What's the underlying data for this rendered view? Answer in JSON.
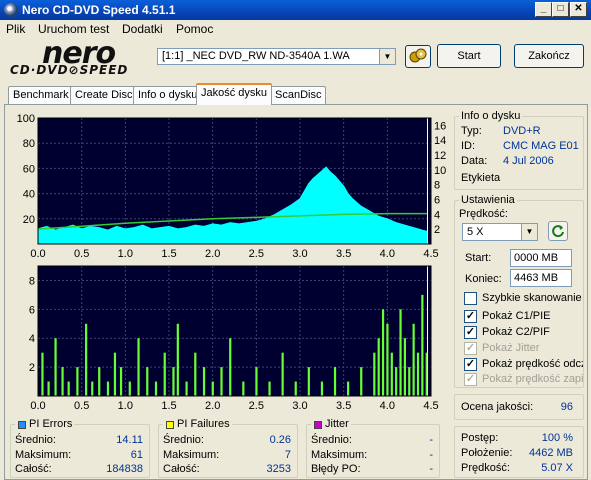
{
  "window": {
    "title": "Nero CD-DVD Speed 4.51.1"
  },
  "menu": [
    "Plik",
    "Uruchom test",
    "Dodatki",
    "Pomoc"
  ],
  "logo": {
    "line1": "nero",
    "line2": "CD·DVD⊘SPEED"
  },
  "toolbar": {
    "drive": "[1:1]  _NEC DVD_RW ND-3540A 1.WA",
    "start_label": "Start",
    "end_label": "Zakończ"
  },
  "tabs": [
    {
      "label": "Benchmark",
      "active": false
    },
    {
      "label": "Create Disc",
      "active": false
    },
    {
      "label": "Info o dysku",
      "active": false
    },
    {
      "label": "Jakość dysku",
      "active": true
    },
    {
      "label": "ScanDisc",
      "active": false
    }
  ],
  "disc_info": {
    "title": "Info o dysku",
    "type_label": "Typ:",
    "type_value": "DVD+R",
    "id_label": "ID:",
    "id_value": "CMC MAG E01",
    "date_label": "Data:",
    "date_value": "4 Jul 2006",
    "label_label": "Etykieta"
  },
  "settings": {
    "title": "Ustawienia",
    "speed_label": "Prędkość:",
    "speed_value": "5 X",
    "start_label": "Start:",
    "start_value": "0000 MB",
    "end_label": "Koniec:",
    "end_value": "4463 MB",
    "checkboxes": [
      {
        "label": "Szybkie skanowanie",
        "checked": false,
        "disabled": false
      },
      {
        "label": "Pokaż C1/PIE",
        "checked": true,
        "disabled": false
      },
      {
        "label": "Pokaż C2/PIF",
        "checked": true,
        "disabled": false
      },
      {
        "label": "Pokaż Jitter",
        "checked": true,
        "disabled": true
      },
      {
        "label": "Pokaż prędkość odczy",
        "checked": true,
        "disabled": false
      },
      {
        "label": "Pokaż prędkość zapisu",
        "checked": true,
        "disabled": true
      }
    ]
  },
  "quality": {
    "label": "Ocena jakości:",
    "value": "96"
  },
  "progress": {
    "progress_label": "Postęp:",
    "progress_value": "100 %",
    "position_label": "Położenie:",
    "position_value": "4462 MB",
    "speed_label": "Prędkość:",
    "speed_value": "5.07 X"
  },
  "pi_errors": {
    "title": "PI Errors",
    "avg_label": "Średnio:",
    "avg_value": "14.11",
    "max_label": "Maksimum:",
    "max_value": "61",
    "total_label": "Całość:",
    "total_value": "184838"
  },
  "pi_failures": {
    "title": "PI Failures",
    "avg_label": "Średnio:",
    "avg_value": "0.26",
    "max_label": "Maksimum:",
    "max_value": "7",
    "total_label": "Całość:",
    "total_value": "3253"
  },
  "jitter": {
    "title": "Jitter",
    "avg_label": "Średnio:",
    "avg_value": "-",
    "max_label": "Maksimum:",
    "max_value": "-",
    "po_label": "Błędy PO:",
    "po_value": "-"
  },
  "colors": {
    "pie": "#00ffff",
    "pif": "#66ff33",
    "speed": "#33cc33",
    "chart_bg": "#000030",
    "jitter": "#cc00cc",
    "pi_swatch": "#1e90ff",
    "pif_swatch": "#ffff00"
  },
  "chart_data": [
    {
      "type": "area",
      "x_ticks": [
        "0.0",
        "0.5",
        "1.0",
        "1.5",
        "2.0",
        "2.5",
        "3.0",
        "3.5",
        "4.0",
        "4.5"
      ],
      "y_left_ticks": [
        "100",
        "80",
        "60",
        "40",
        "20"
      ],
      "y_right_ticks": [
        "16",
        "14",
        "12",
        "10",
        "8",
        "6",
        "4",
        "2"
      ],
      "xlim": [
        0,
        4.5
      ],
      "ylim": [
        0,
        100
      ],
      "y2lim": [
        0,
        17
      ],
      "series": [
        {
          "values": [
            [
              0.0,
              12
            ],
            [
              0.1,
              14
            ],
            [
              0.2,
              11
            ],
            [
              0.3,
              13
            ],
            [
              0.4,
              15
            ],
            [
              0.5,
              12
            ],
            [
              0.6,
              14
            ],
            [
              0.7,
              13
            ],
            [
              0.8,
              11
            ],
            [
              0.9,
              14
            ],
            [
              1.0,
              12
            ],
            [
              1.1,
              13
            ],
            [
              1.2,
              15
            ],
            [
              1.3,
              12
            ],
            [
              1.4,
              13
            ],
            [
              1.5,
              14
            ],
            [
              1.6,
              12
            ],
            [
              1.7,
              13
            ],
            [
              1.8,
              15
            ],
            [
              1.9,
              14
            ],
            [
              2.0,
              16
            ],
            [
              2.1,
              15
            ],
            [
              2.2,
              17
            ],
            [
              2.3,
              16
            ],
            [
              2.4,
              17
            ],
            [
              2.5,
              18
            ],
            [
              2.6,
              20
            ],
            [
              2.7,
              23
            ],
            [
              2.8,
              27
            ],
            [
              2.9,
              31
            ],
            [
              3.0,
              36
            ],
            [
              3.05,
              42
            ],
            [
              3.1,
              48
            ],
            [
              3.15,
              52
            ],
            [
              3.2,
              55
            ],
            [
              3.25,
              58
            ],
            [
              3.3,
              61
            ],
            [
              3.35,
              57
            ],
            [
              3.4,
              54
            ],
            [
              3.45,
              50
            ],
            [
              3.5,
              46
            ],
            [
              3.55,
              40
            ],
            [
              3.6,
              36
            ],
            [
              3.7,
              30
            ],
            [
              3.8,
              26
            ],
            [
              3.9,
              22
            ],
            [
              4.0,
              20
            ],
            [
              4.1,
              17
            ],
            [
              4.2,
              15
            ],
            [
              4.3,
              13
            ],
            [
              4.4,
              11
            ],
            [
              4.46,
              10
            ]
          ]
        },
        {
          "axis": "right",
          "values": [
            [
              0.0,
              2.0
            ],
            [
              0.5,
              2.4
            ],
            [
              1.0,
              2.8
            ],
            [
              1.5,
              3.1
            ],
            [
              2.0,
              3.4
            ],
            [
              2.5,
              3.6
            ],
            [
              3.0,
              3.8
            ],
            [
              3.5,
              4.0
            ],
            [
              4.0,
              4.1
            ],
            [
              4.46,
              4.1
            ]
          ]
        }
      ]
    },
    {
      "type": "bar",
      "x_ticks": [
        "0.0",
        "0.5",
        "1.0",
        "1.5",
        "2.0",
        "2.5",
        "3.0",
        "3.5",
        "4.0",
        "4.5"
      ],
      "y_ticks": [
        "8",
        "6",
        "4",
        "2"
      ],
      "xlim": [
        0,
        4.5
      ],
      "ylim": [
        0,
        9
      ],
      "series": [
        {
          "values": [
            [
              0.05,
              3
            ],
            [
              0.12,
              1
            ],
            [
              0.2,
              4
            ],
            [
              0.28,
              2
            ],
            [
              0.35,
              1
            ],
            [
              0.45,
              2
            ],
            [
              0.55,
              5
            ],
            [
              0.62,
              1
            ],
            [
              0.7,
              2
            ],
            [
              0.8,
              1
            ],
            [
              0.88,
              3
            ],
            [
              0.95,
              2
            ],
            [
              1.05,
              1
            ],
            [
              1.15,
              4
            ],
            [
              1.25,
              2
            ],
            [
              1.35,
              1
            ],
            [
              1.45,
              3
            ],
            [
              1.55,
              2
            ],
            [
              1.6,
              5
            ],
            [
              1.7,
              1
            ],
            [
              1.8,
              3
            ],
            [
              1.9,
              2
            ],
            [
              2.0,
              1
            ],
            [
              2.1,
              2
            ],
            [
              2.2,
              4
            ],
            [
              2.35,
              1
            ],
            [
              2.5,
              2
            ],
            [
              2.65,
              1
            ],
            [
              2.8,
              3
            ],
            [
              2.95,
              1
            ],
            [
              3.1,
              2
            ],
            [
              3.25,
              1
            ],
            [
              3.4,
              2
            ],
            [
              3.55,
              1
            ],
            [
              3.7,
              2
            ],
            [
              3.85,
              3
            ],
            [
              3.9,
              4
            ],
            [
              3.95,
              6
            ],
            [
              4.0,
              5
            ],
            [
              4.05,
              3
            ],
            [
              4.1,
              2
            ],
            [
              4.15,
              6
            ],
            [
              4.2,
              4
            ],
            [
              4.25,
              2
            ],
            [
              4.3,
              5
            ],
            [
              4.35,
              3
            ],
            [
              4.4,
              7
            ],
            [
              4.45,
              3
            ]
          ]
        }
      ]
    }
  ]
}
